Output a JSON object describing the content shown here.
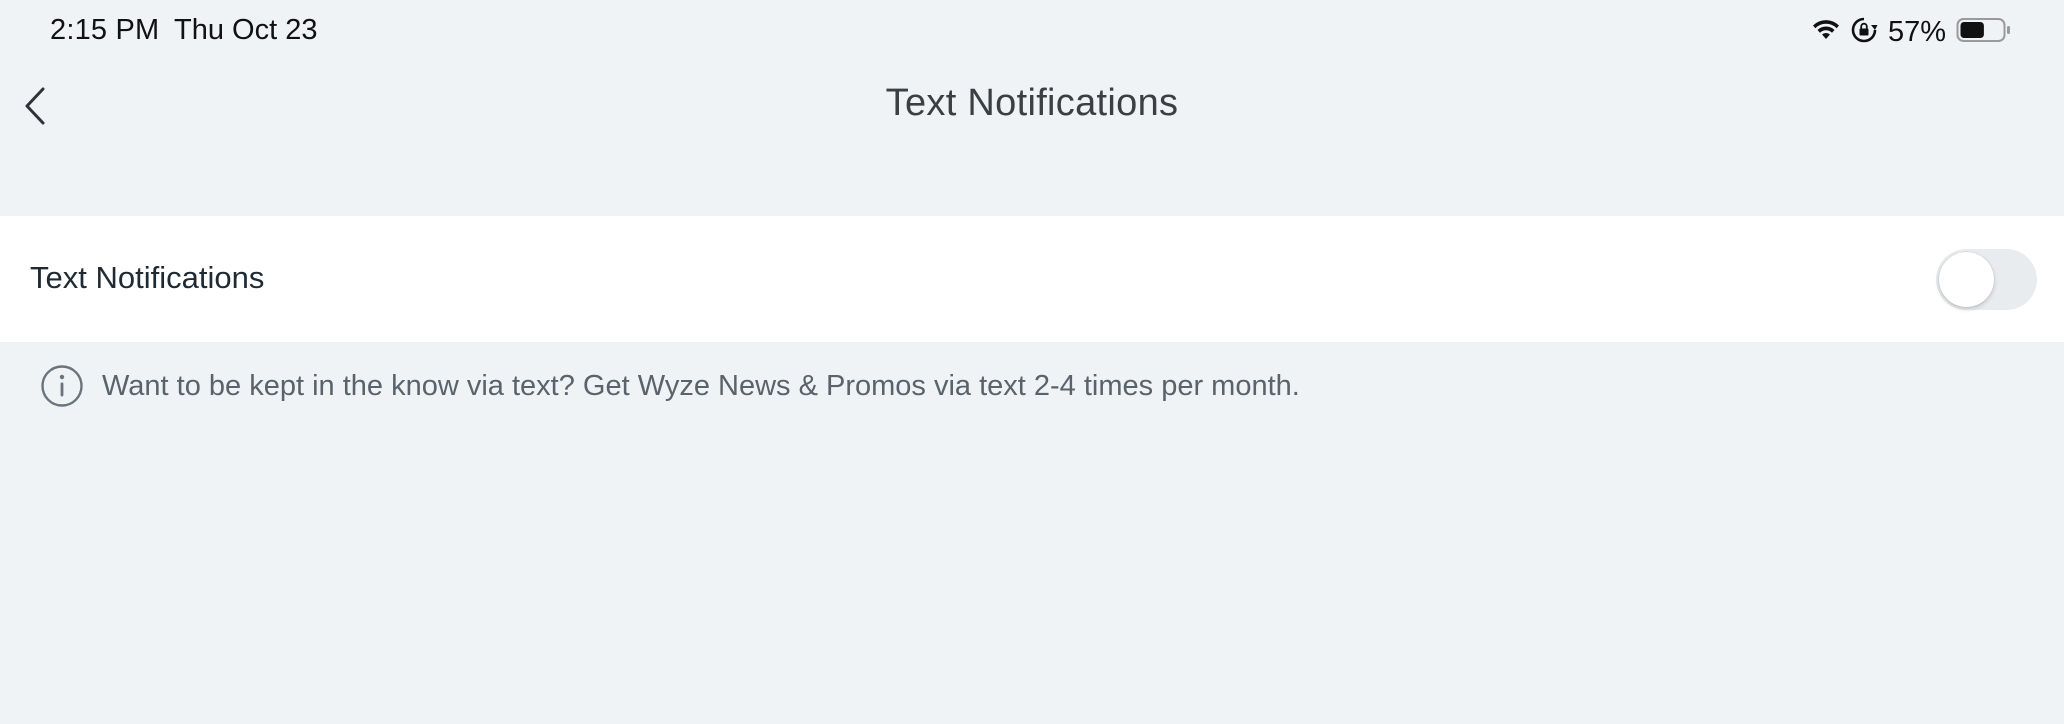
{
  "status_bar": {
    "time": "2:15 PM",
    "date": "Thu Oct 23",
    "battery_percent": "57%",
    "battery_level": 0.57,
    "icons": [
      "wifi-icon",
      "orientation-lock-icon",
      "battery-icon"
    ]
  },
  "nav": {
    "title": "Text Notifications",
    "back_icon": "chevron-left-icon"
  },
  "settings": {
    "text_notifications": {
      "label": "Text Notifications",
      "enabled": false
    }
  },
  "info": {
    "icon": "info-icon",
    "text": "Want to be kept in the know via text? Get Wyze News & Promos via text 2-4 times per month."
  },
  "colors": {
    "background": "#eff3f6",
    "row_background": "#ffffff",
    "title_text": "#3a3f44",
    "toggle_off": "#e9ecef"
  }
}
